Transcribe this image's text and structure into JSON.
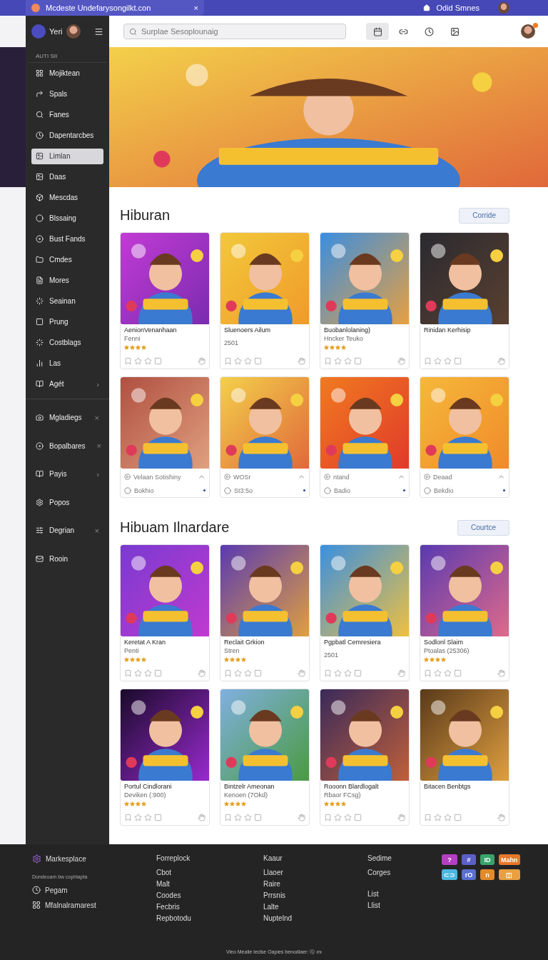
{
  "browser_tab": {
    "title": "Mcdeste Undefarysongilkt.con",
    "close": "×",
    "user": "Odid Smnes"
  },
  "header": {
    "brand": "Yeri",
    "search": {
      "placeholder": "Surplae Sesoplounaig"
    },
    "toolbar": [
      {
        "selected": true
      },
      {
        "selected": false
      },
      {
        "selected": false
      },
      {
        "selected": false
      }
    ]
  },
  "sidebar": {
    "heading": "AUTI SII",
    "items": [
      {
        "label": "Mojiktean",
        "selected": false
      },
      {
        "label": "Spals",
        "selected": false
      },
      {
        "label": "Fanes",
        "selected": false
      },
      {
        "label": "Dapentarcbes",
        "selected": false
      },
      {
        "label": "Limlan",
        "selected": true
      },
      {
        "label": "Daas",
        "selected": false
      },
      {
        "label": "Mescdas",
        "selected": false
      },
      {
        "label": "Blssaing",
        "selected": false
      },
      {
        "label": "Bust Fands",
        "selected": false
      },
      {
        "label": "Cmdes",
        "selected": false
      },
      {
        "label": "Mores",
        "selected": false
      },
      {
        "label": "Seainan",
        "selected": false
      },
      {
        "label": "Prung",
        "selected": false
      },
      {
        "label": "Costblags",
        "selected": false
      },
      {
        "label": "Las",
        "selected": false
      },
      {
        "label": "Agét",
        "selected": false,
        "trailing": "›"
      }
    ],
    "groups": [
      {
        "label": "Mgladiegs",
        "selected": false,
        "trailing": "×"
      },
      {
        "label": "Bopalbares",
        "selected": false,
        "trailing": "×"
      },
      {
        "label": "Payis",
        "selected": false,
        "trailing": "›"
      },
      {
        "label": "Popos",
        "selected": false
      },
      {
        "label": "Degrian",
        "selected": false,
        "trailing": "×"
      },
      {
        "label": "Rooin",
        "selected": false
      }
    ]
  },
  "sections": [
    {
      "title": "Hiburan",
      "action": "Corride",
      "rows": [
        [
          {
            "kind": "game",
            "title": "AenionVenanhaan",
            "subtitle": "Fenni",
            "stars": 4
          },
          {
            "kind": "game",
            "title": "Sluenoers Ailum",
            "meta": "2501"
          },
          {
            "kind": "game",
            "title": "Buobanlolaning)",
            "subtitle": "Hncker Teuko",
            "stars": 4
          },
          {
            "kind": "game",
            "title": "Rinidan Kerhisip"
          }
        ],
        [
          {
            "kind": "media",
            "line1": "Velaan Sotishiny",
            "line2": "Bokhio"
          },
          {
            "kind": "media",
            "line1": "WOSr",
            "line2": "St3:5o"
          },
          {
            "kind": "media",
            "line1": "ntand",
            "line2": "Badio"
          },
          {
            "kind": "media",
            "line1": "Deaad",
            "line2": "Bekdio"
          }
        ]
      ]
    },
    {
      "title": "Hibuam Ilnardare",
      "action": "Courtce",
      "rows": [
        [
          {
            "kind": "game",
            "title": "Keretat A Kran",
            "subtitle": "Penti",
            "stars": 4
          },
          {
            "kind": "game",
            "title": "Reclait Grkion",
            "subtitle": "Stren",
            "stars": 4
          },
          {
            "kind": "game",
            "title": "Pgpbatl Cemresiera",
            "meta": "2501"
          },
          {
            "kind": "game",
            "title": "Sodlonl Slaim",
            "subtitle": "Ptoalas (25306)",
            "stars": 4
          }
        ],
        [
          {
            "kind": "game",
            "title": "Portul Cindlorani",
            "subtitle": "Deviken (:900)",
            "stars": 4
          },
          {
            "kind": "game",
            "title": "Bintzelr Ameonan",
            "subtitle": "Kenoen (7Okd)",
            "stars": 4
          },
          {
            "kind": "game",
            "title": "Rooonn Blardlogalt",
            "subtitle": "Rbaor FCsg)",
            "stars": 4
          },
          {
            "kind": "game",
            "title": "Bitacen Benbtgs"
          }
        ]
      ]
    }
  ],
  "footer": {
    "brand": "Markesplace",
    "tagline": "Dundeoam bw cophlapta",
    "links": [
      "Pegam",
      "Mfalnalramarest"
    ],
    "columns": [
      [
        "Forreplock",
        "Cbot",
        "Malt",
        "Coodes",
        "Fecbris",
        "Repbotodu"
      ],
      [
        "Kaaur",
        "Llaoer",
        "Raire",
        "Prrsnis",
        "Lalte",
        "Nuptelnd"
      ],
      [
        "Sedime",
        "Corges",
        "List",
        "Llist"
      ]
    ],
    "badges": [
      {
        "label": "?",
        "color": "#b43fc0"
      },
      {
        "label": "#",
        "color": "#5b5fc7"
      },
      {
        "label": "ID",
        "color": "#3aa36b"
      },
      {
        "label": "Mahn",
        "color": "#e5782a"
      },
      {
        "label": "⊂⊃",
        "color": "#4cb8e0"
      },
      {
        "label": "rO",
        "color": "#5b6fcf"
      },
      {
        "label": "n",
        "color": "#e38a2a"
      },
      {
        "label": "◫",
        "color": "#e8a040"
      }
    ],
    "copyright": "Vieo Mealie leclse Oapies benodlaer: ⓒ ını"
  }
}
